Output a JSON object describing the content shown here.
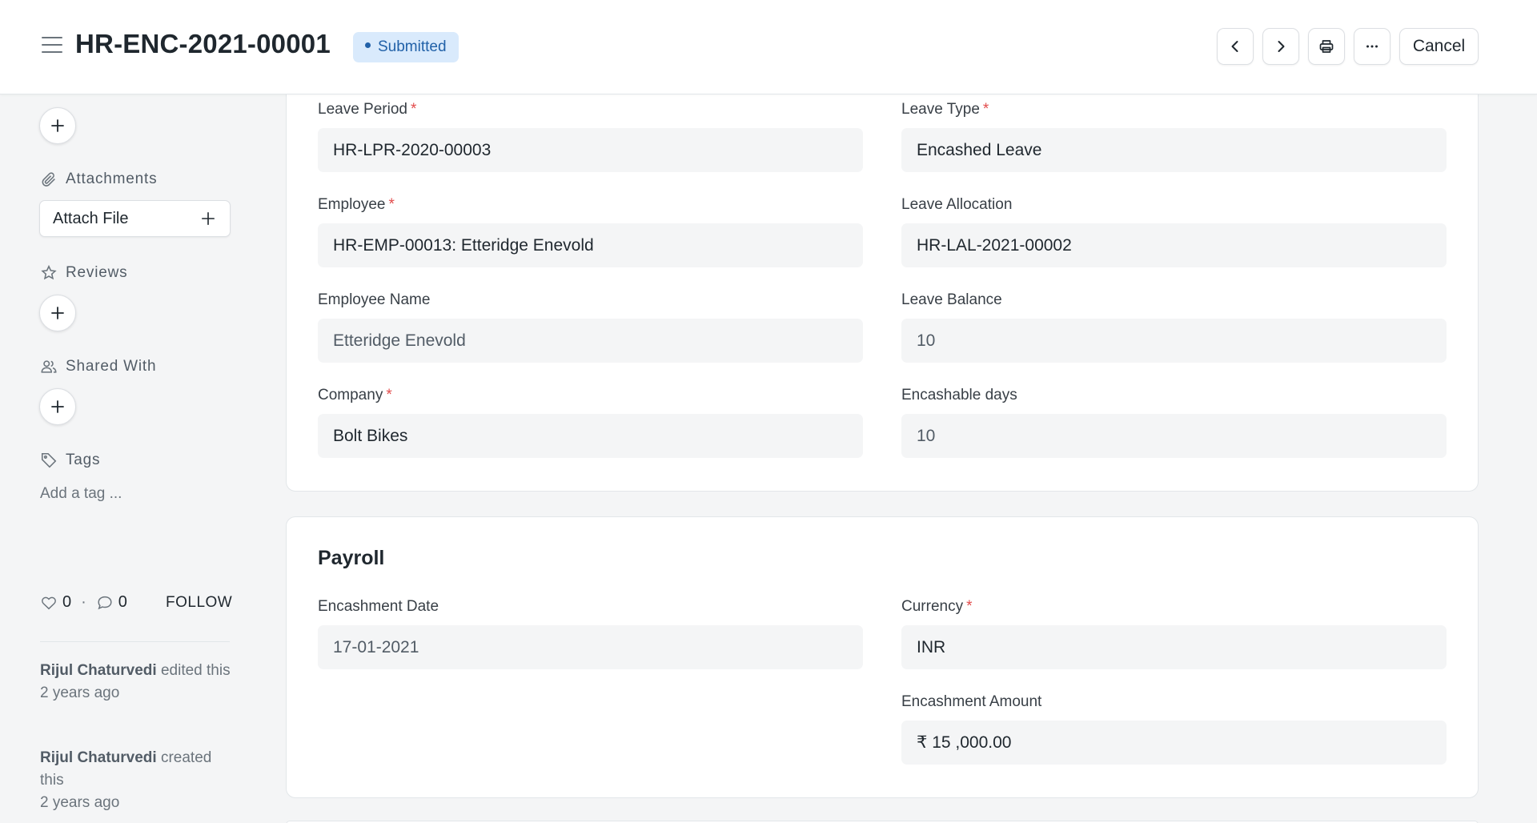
{
  "header": {
    "title": "HR-ENC-2021-00001",
    "status": "Submitted",
    "cancel_label": "Cancel",
    "icons": [
      "menu-icon",
      "chevron-left-icon",
      "chevron-right-icon",
      "printer-icon",
      "more-icon"
    ]
  },
  "sidebar": {
    "attachments_label": "Attachments",
    "attach_file_label": "Attach File",
    "reviews_label": "Reviews",
    "shared_with_label": "Shared With",
    "tags_label": "Tags",
    "add_tag_placeholder": "Add a tag ...",
    "likes_count": "0",
    "separator": "·",
    "comments_count": "0",
    "follow_label": "FOLLOW",
    "activity": [
      {
        "user": "Rijul Chaturvedi",
        "action": "edited this",
        "time": "2 years ago"
      },
      {
        "user": "Rijul Chaturvedi",
        "action": "created this",
        "time": "2 years ago"
      }
    ]
  },
  "form": {
    "leave_period": {
      "label": "Leave Period",
      "value": "HR-LPR-2020-00003"
    },
    "leave_type": {
      "label": "Leave Type",
      "value": "Encashed Leave"
    },
    "employee": {
      "label": "Employee",
      "value": "HR-EMP-00013: Etteridge Enevold"
    },
    "leave_allocation": {
      "label": "Leave Allocation",
      "value": "HR-LAL-2021-00002"
    },
    "employee_name": {
      "label": "Employee Name",
      "value": "Etteridge Enevold"
    },
    "leave_balance": {
      "label": "Leave Balance",
      "value": "10"
    },
    "company": {
      "label": "Company",
      "value": "Bolt Bikes"
    },
    "encashable_days": {
      "label": "Encashable days",
      "value": "10"
    }
  },
  "payroll": {
    "section_title": "Payroll",
    "encashment_date": {
      "label": "Encashment Date",
      "value": "17-01-2021"
    },
    "currency": {
      "label": "Currency",
      "value": "INR"
    },
    "encashment_amount": {
      "label": "Encashment Amount",
      "value": "₹ 15 ,000.00"
    }
  },
  "colors": {
    "accent": "#2161a8",
    "badge_bg": "#d9eafc",
    "required": "#e24c4c",
    "page_bg": "#f4f5f6"
  }
}
